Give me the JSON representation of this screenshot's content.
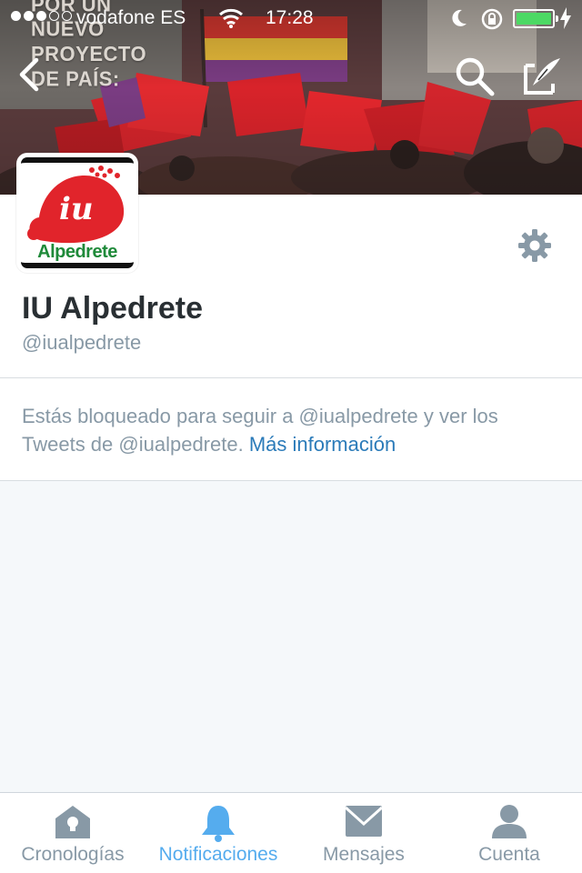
{
  "status_bar": {
    "carrier": "vodafone ES",
    "time": "17:28",
    "battery_level": 1.0,
    "colors": {
      "battery": "#4cd964"
    }
  },
  "banner": {
    "overlay_text": "POR UN\nNUEVO\nPROYECTO\nDE PAÍS:"
  },
  "avatar": {
    "logo_text": "Alpedrete"
  },
  "profile": {
    "name": "IU Alpedrete",
    "handle": "@iualpedrete",
    "settings_icon": "gear-icon"
  },
  "blocked_notice": {
    "message": "Estás bloqueado para seguir a @iualpedrete y ver los Tweets de @iualpedrete.",
    "link": "Más información"
  },
  "tabs": [
    {
      "label": "Cronologías",
      "icon": "home-icon",
      "active": false
    },
    {
      "label": "Notificaciones",
      "icon": "bell-icon",
      "active": true
    },
    {
      "label": "Mensajes",
      "icon": "envelope-icon",
      "active": false
    },
    {
      "label": "Cuenta",
      "icon": "person-icon",
      "active": false
    }
  ],
  "colors": {
    "accent": "#55acee",
    "link": "#2b7bb9",
    "muted": "#8899a6",
    "text": "#292f33",
    "background": "#f5f8fa"
  }
}
